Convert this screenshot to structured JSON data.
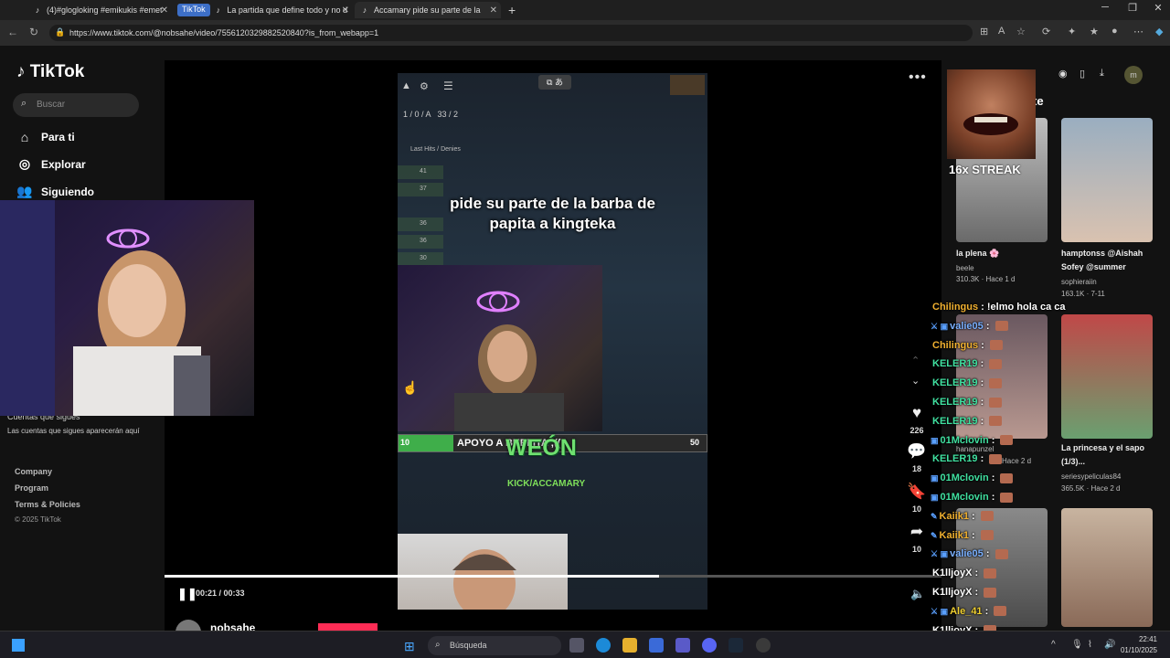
{
  "browser": {
    "tabs": [
      {
        "title": "(4)#glogloking #emikukis #emet"
      },
      {
        "title": "La partida que define todo y no d"
      },
      {
        "title": "Accamary pide su parte de la"
      }
    ],
    "tiktok_chip": "TikTok",
    "url": "https://www.tiktok.com/@nobsahe/video/7556120329882520840?is_from_webapp=1"
  },
  "sidebar": {
    "logo": "TikTok",
    "search_placeholder": "Buscar",
    "nav": [
      {
        "label": "Para ti",
        "icon": "home-icon"
      },
      {
        "label": "Explorar",
        "icon": "compass-icon"
      },
      {
        "label": "Siguiendo",
        "icon": "users-icon"
      }
    ],
    "following_title": "Cuentas que sigues",
    "following_desc": "Las cuentas que sigues aparecerán aquí",
    "footer": [
      "Company",
      "Program",
      "Terms & Policies"
    ],
    "copyright": "© 2025 TikTok"
  },
  "video": {
    "caption_line1": "pide su parte de la barba de",
    "caption_line2": "papita a kingteka",
    "support_left": "10",
    "support_text": "APOYO A   BUELITA ;((",
    "support_right": "50",
    "overlay_big": "WEÓN",
    "kick": "KICK/ACCAMARY",
    "hud_header": "Last Hits / Denies",
    "hud_stats": [
      "41",
      "37",
      "36",
      "36",
      "30"
    ],
    "time": "00:21 / 00:33",
    "progress": 0.636,
    "author": "nobsahe"
  },
  "actions": {
    "likes": "226",
    "comments": "18",
    "saves": "10",
    "shares": "10"
  },
  "right": {
    "header": "rte",
    "streak": "16x STREAK",
    "avatar_letter": "m",
    "cards": [
      {
        "title": "la plena 🌸",
        "user": "beele",
        "meta": "310.3K · Hace 1 d"
      },
      {
        "title": "hamptonss @Aishah Sofey @summer",
        "user": "sophieraiin",
        "meta": "163.1K · 7-11"
      },
      {
        "title": "",
        "user": "hanapunzel",
        "meta": "Hace 2 d"
      },
      {
        "title": "La princesa y el sapo (1/3)...",
        "user": "seriesypeliculas84",
        "meta": "365.5K · Hace 2 d"
      }
    ]
  },
  "chat": [
    {
      "user": "Chilingus",
      "msg": "!elmo hola ca ca",
      "color": "#f0b030",
      "badges": "",
      "emote": false
    },
    {
      "user": "valie05",
      "msg": "",
      "color": "#7ab0ff",
      "badges": "⚔ ▣",
      "emote": true
    },
    {
      "user": "Chilingus",
      "msg": "",
      "color": "#f0b030",
      "badges": "",
      "emote": true
    },
    {
      "user": "KELER19",
      "msg": "",
      "color": "#40e0a0",
      "badges": "",
      "emote": true
    },
    {
      "user": "KELER19",
      "msg": "",
      "color": "#40e0a0",
      "badges": "",
      "emote": true
    },
    {
      "user": "KELER19",
      "msg": "",
      "color": "#40e0a0",
      "badges": "",
      "emote": true
    },
    {
      "user": "KELER19",
      "msg": "",
      "color": "#40e0a0",
      "badges": "",
      "emote": true
    },
    {
      "user": "01Mclovin",
      "msg": "",
      "color": "#40e0a0",
      "badges": "▣",
      "emote": true
    },
    {
      "user": "KELER19",
      "msg": "",
      "color": "#40e0a0",
      "badges": "",
      "emote": true
    },
    {
      "user": "01Mclovin",
      "msg": "",
      "color": "#40e0a0",
      "badges": "▣",
      "emote": true
    },
    {
      "user": "01Mclovin",
      "msg": "",
      "color": "#40e0a0",
      "badges": "▣",
      "emote": true
    },
    {
      "user": "Kaiik1",
      "msg": "",
      "color": "#f0b030",
      "badges": "✎",
      "emote": true
    },
    {
      "user": "Kaiik1",
      "msg": "",
      "color": "#f0b030",
      "badges": "✎",
      "emote": true
    },
    {
      "user": "valie05",
      "msg": "",
      "color": "#7ab0ff",
      "badges": "⚔ ▣",
      "emote": true
    },
    {
      "user": "K1lljoyX",
      "msg": "",
      "color": "#ffffff",
      "badges": "",
      "emote": true
    },
    {
      "user": "K1lljoyX",
      "msg": "",
      "color": "#ffffff",
      "badges": "",
      "emote": true
    },
    {
      "user": "Ale_41",
      "msg": "",
      "color": "#f0d030",
      "badges": "⚔ ▣",
      "emote": true
    },
    {
      "user": "K1lljoyX",
      "msg": "",
      "color": "#ffffff",
      "badges": "",
      "emote": true
    }
  ],
  "taskbar": {
    "search": "Búsqueda",
    "time": "22:41",
    "date": "01/10/2025"
  }
}
